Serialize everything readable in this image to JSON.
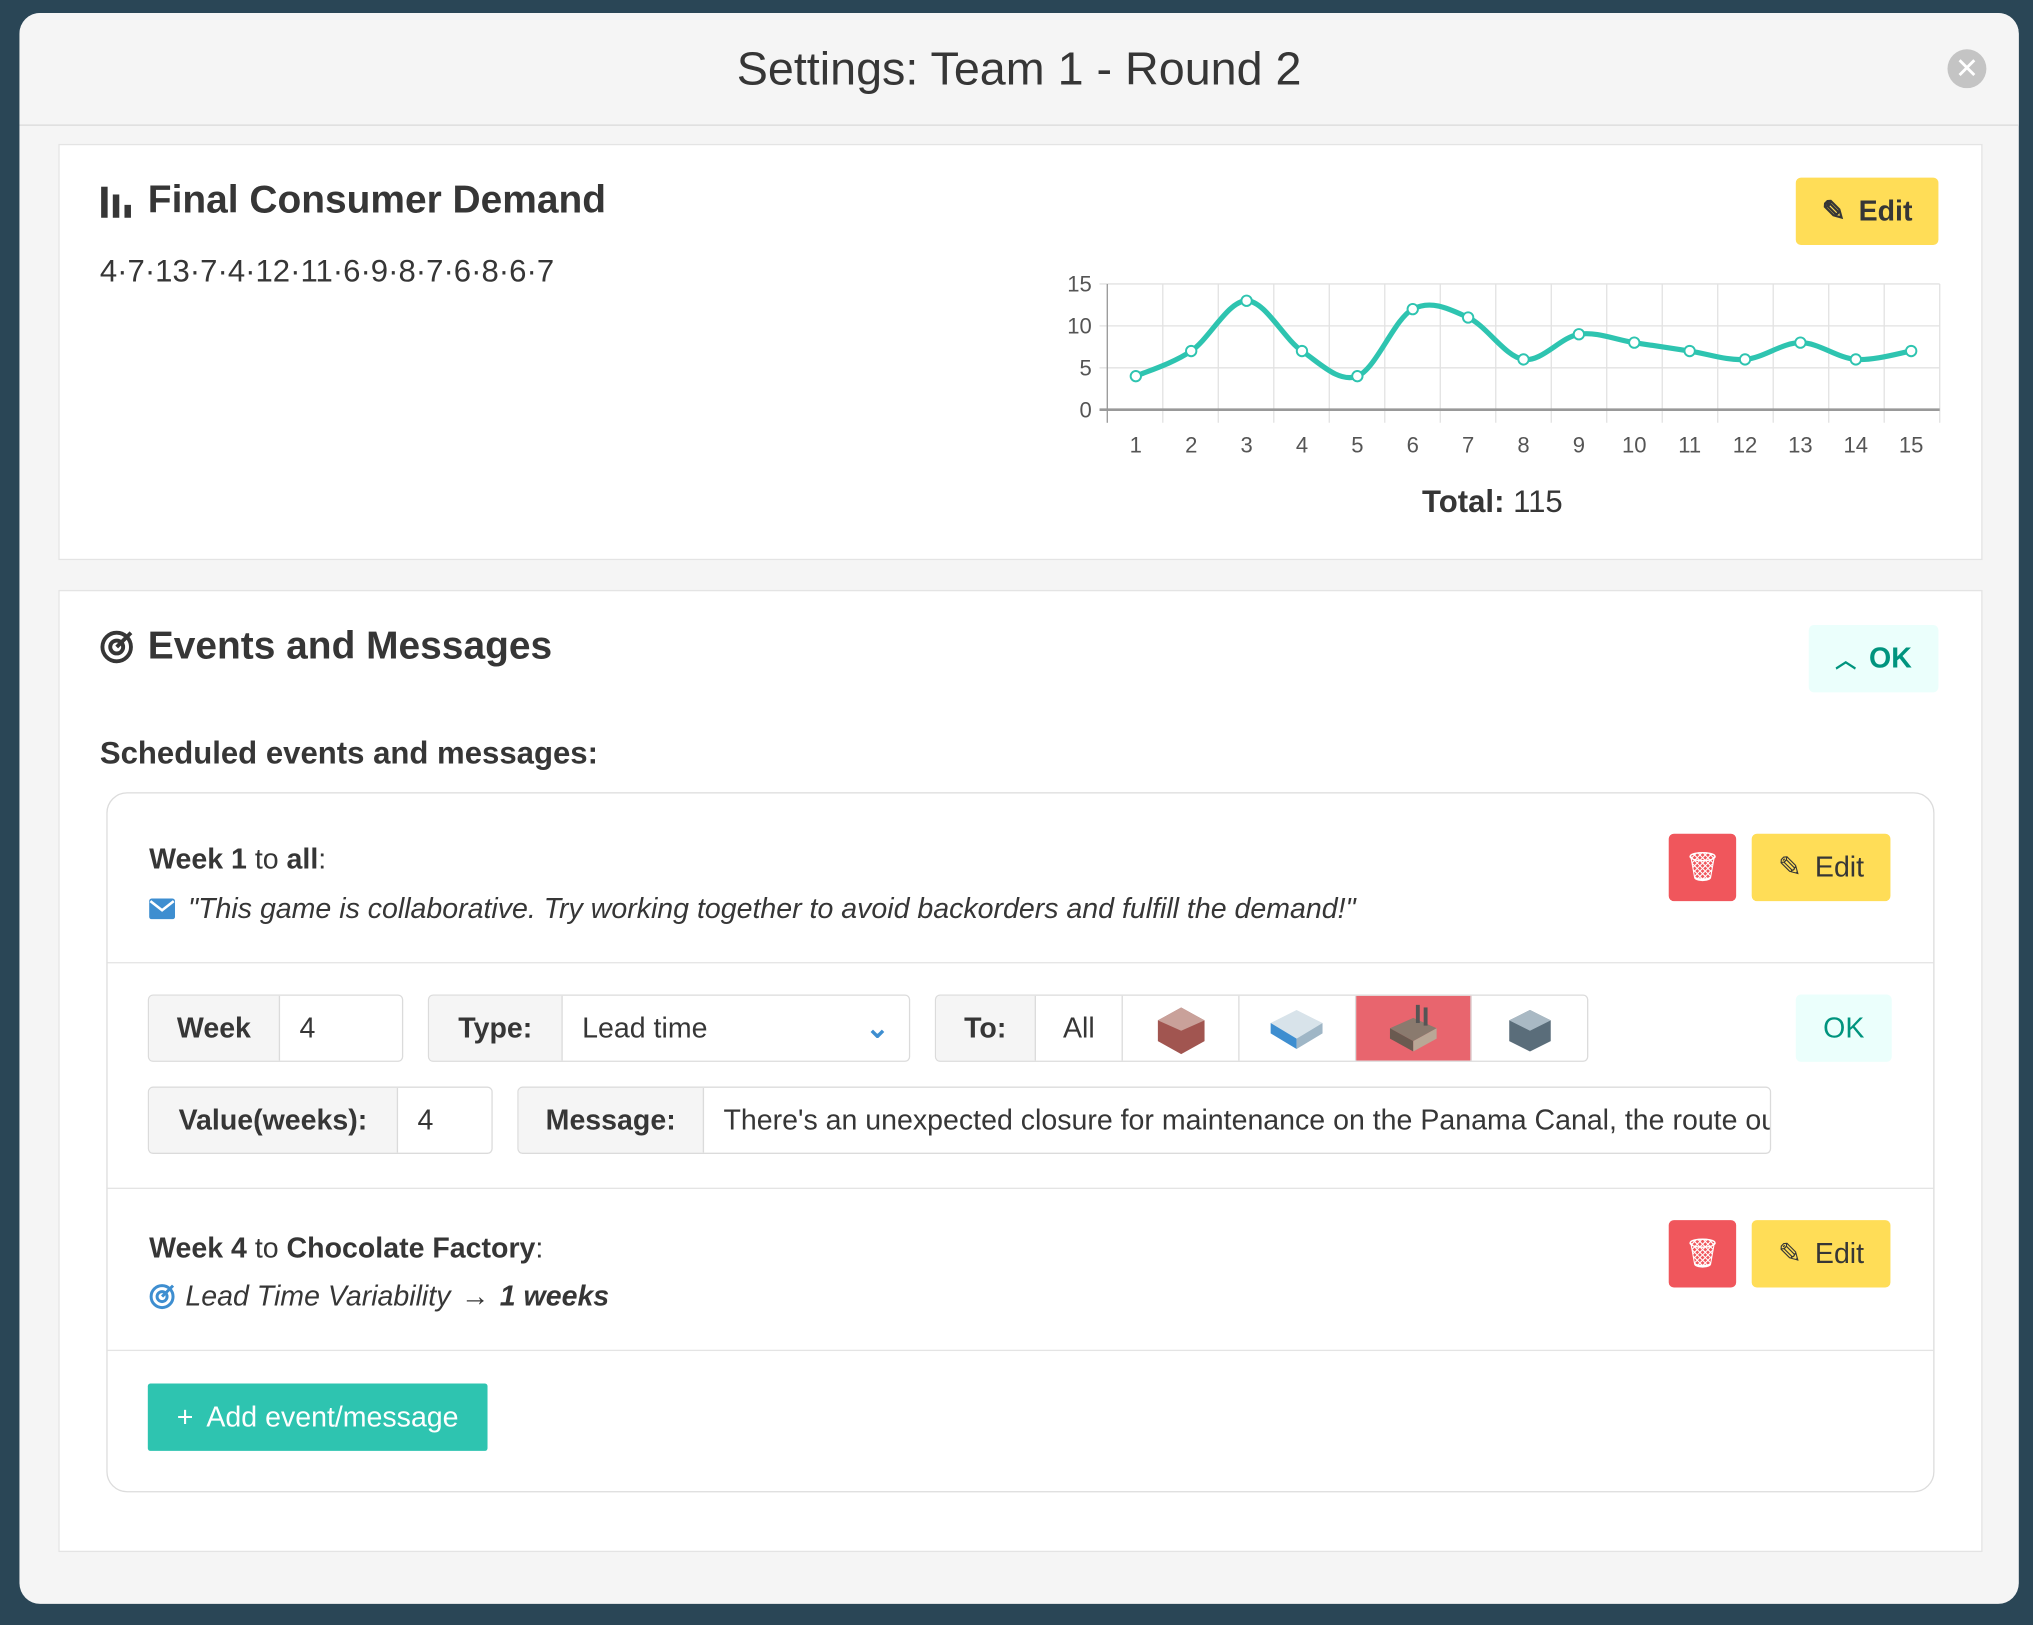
{
  "modal": {
    "title": "Settings: Team 1 - Round 2",
    "close_icon": "close-circle-icon"
  },
  "demand": {
    "title": "Final Consumer Demand",
    "sequence": "4·7·13·7·4·12·11·6·9·8·7·6·8·6·7",
    "edit_label": "Edit",
    "total_label": "Total:",
    "total_value": "115"
  },
  "chart_data": {
    "type": "line",
    "x": [
      1,
      2,
      3,
      4,
      5,
      6,
      7,
      8,
      9,
      10,
      11,
      12,
      13,
      14,
      15
    ],
    "values": [
      4,
      7,
      13,
      7,
      4,
      12,
      11,
      6,
      9,
      8,
      7,
      6,
      8,
      6,
      7
    ],
    "yticks": [
      0,
      5,
      10,
      15
    ],
    "ylim": [
      0,
      15
    ],
    "grid": true,
    "smooth": true,
    "color": "#2ec4b0"
  },
  "events": {
    "title": "Events and Messages",
    "ok_label": "OK",
    "scheduled_label": "Scheduled events and messages:",
    "item1": {
      "week": "Week 1",
      "to": " to ",
      "target": "all",
      "colon": ":",
      "message": "\"This game is collaborative. Try working together to avoid backorders and fulfill the demand!\"",
      "edit_label": "Edit"
    },
    "editor": {
      "week_label": "Week",
      "week_value": "4",
      "type_label": "Type:",
      "type_value": "Lead time",
      "to_label": "To:",
      "to_all": "All",
      "value_label": "Value(weeks):",
      "value_value": "4",
      "message_label": "Message:",
      "message_value": "There's an unexpected closure for maintenance on the Panama Canal, the route our",
      "ok_label": "OK",
      "selected_recipient": "factory"
    },
    "item2": {
      "week": "Week 4",
      "to": " to ",
      "target": "Chocolate Factory",
      "colon": ":",
      "event": "Lead Time Variability",
      "arrow": "→",
      "result": "1 weeks",
      "edit_label": "Edit"
    },
    "add_label": "Add event/message"
  },
  "colors": {
    "accent": "#2ec4b0",
    "warning": "#ffdd57",
    "danger": "#f0565c",
    "selected": "#e8656e"
  }
}
